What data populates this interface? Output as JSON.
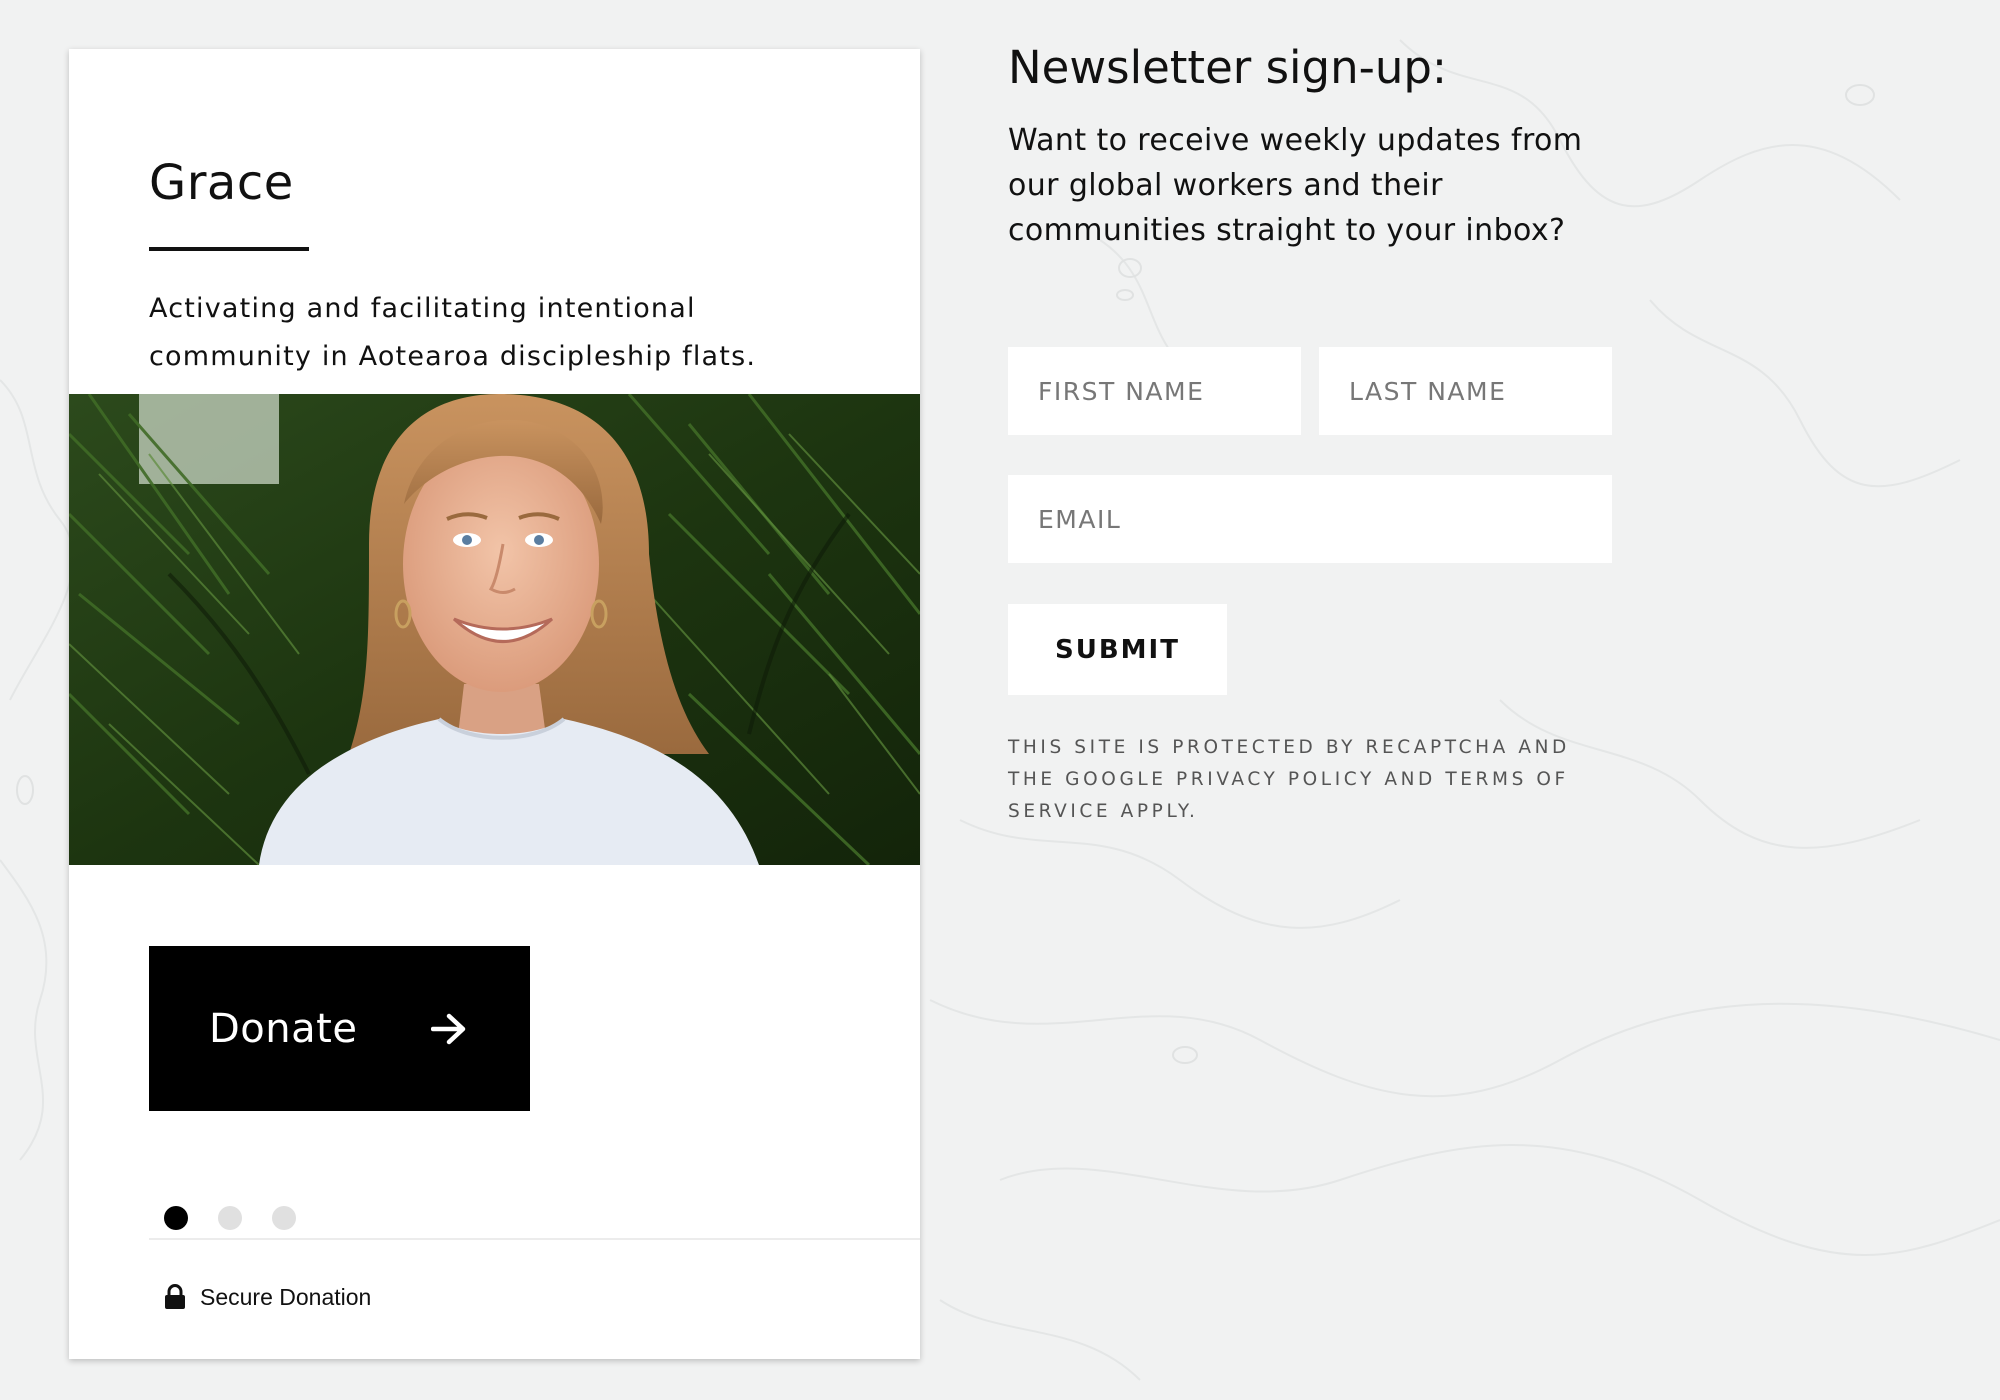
{
  "card": {
    "name": "Grace",
    "description": "Activating and facilitating intentional community in Aotearoa discipleship flats.",
    "donate_label": "Donate",
    "donate_icon": "arrow-right-icon",
    "carousel": {
      "total": 3,
      "active_index": 0
    },
    "secure_icon": "lock-icon",
    "secure_label": "Secure Donation"
  },
  "newsletter": {
    "title": "Newsletter sign-up:",
    "description": "Want to receive weekly updates from our global workers and their communities straight to your inbox?",
    "first_name_placeholder": "FIRST NAME",
    "last_name_placeholder": "LAST NAME",
    "email_placeholder": "EMAIL",
    "submit_label": "SUBMIT",
    "recaptcha_note": "THIS SITE IS PROTECTED BY RECAPTCHA AND THE GOOGLE PRIVACY POLICY AND TERMS OF SERVICE APPLY."
  },
  "colors": {
    "page_background": "#f1f2f2",
    "card_background": "#ffffff",
    "button_dark": "#000000",
    "dot_active": "#000000",
    "dot_inactive": "#e0e0e0"
  }
}
